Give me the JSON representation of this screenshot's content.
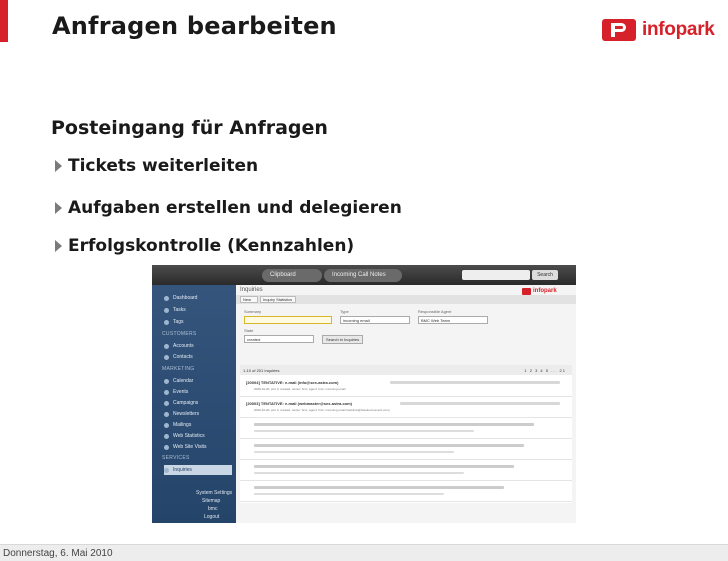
{
  "slide": {
    "title": "Anfragen bearbeiten",
    "brand": "infopark",
    "heading": "Posteingang für Anfragen",
    "bullets": [
      "Tickets weiterleiten",
      "Aufgaben erstellen und delegieren",
      "Erfolgskontrolle (Kennzahlen)"
    ],
    "footer_date": "Donnerstag, 6. Mai 2010",
    "accent_color": "#d6202a"
  },
  "screenshot": {
    "tabs": [
      "Clipboard",
      "Incoming Call Notes"
    ],
    "search_button": "Search",
    "page_title": "Inquiries",
    "brand": "infopark",
    "toolbar": [
      "New",
      "Inquiry Statistics"
    ],
    "sidebar": {
      "items_top": [
        "Dashboard",
        "Tasks",
        "Tags"
      ],
      "section_customers": "CUSTOMERS",
      "items_customers": [
        "Accounts",
        "Contacts"
      ],
      "section_marketing": "MARKETING",
      "items_marketing": [
        "Calendar",
        "Events",
        "Campaigns",
        "Newsletters",
        "Mailings",
        "Web Statistics",
        "Web Site Visits"
      ],
      "section_services": "SERVICES",
      "items_services": [
        "Inquiries"
      ],
      "system_links": [
        "System Settings",
        "Sitemap",
        "bmc",
        "Logout"
      ]
    },
    "filters": {
      "summary_label": "Summary",
      "type_label": "Type",
      "type_value": "incoming email",
      "agent_label": "Responsible Agent",
      "agent_value": "BMC Web Team",
      "state_label": "State",
      "state_value": "created",
      "search_button": "Search in Inquiries"
    },
    "results": {
      "count_label": "1-10 of 201 Inquiries",
      "pagination": "1 2 3 4 5 ... 21",
      "rows": [
        {
          "title": "[20004] TENTATIVE: e-mail (info@sex-astra.com)",
          "sub": "2009-10-20, prio 3, created, owner: bmc, agent: bmc, incoming email"
        },
        {
          "title": "[20003] TENTATIVE: e-mail (webmaster@sex-astra.com)",
          "sub": "2009-10-20, prio 3, created, owner: bmc, agent: bmc, incoming email (webinar@hetelecomevent.com)"
        }
      ]
    }
  }
}
